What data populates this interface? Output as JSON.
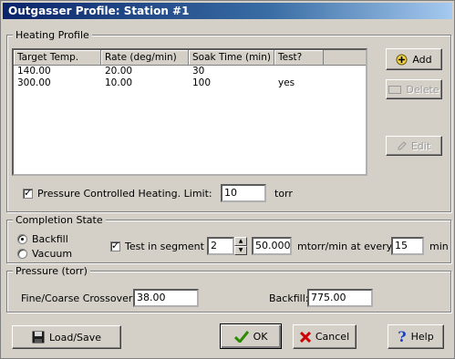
{
  "window": {
    "title": "Outgasser Profile: Station #1"
  },
  "heating_profile": {
    "label": "Heating Profile",
    "columns": [
      "Target Temp.",
      "Rate (deg/min)",
      "Soak Time (min)",
      "Test?"
    ],
    "rows": [
      [
        "140.00",
        "20.00",
        "30",
        ""
      ],
      [
        "300.00",
        "10.00",
        "100",
        "yes"
      ]
    ],
    "add_label": "Add",
    "delete_label": "Delete",
    "edit_label": "Edit",
    "pressure_controlled_label": "Pressure Controlled Heating. Limit:",
    "pressure_controlled_checked": true,
    "limit_value": "10",
    "limit_unit": "torr"
  },
  "completion": {
    "label": "Completion State",
    "backfill_label": "Backfill",
    "vacuum_label": "Vacuum",
    "selected": "Backfill",
    "test_segment_label": "Test in segment",
    "test_segment_checked": true,
    "segment_value": "2",
    "rate_value": "50.000",
    "rate_label": "mtorr/min at every:",
    "every_value": "15",
    "every_unit": "min"
  },
  "pressure": {
    "label": "Pressure (torr)",
    "crossover_label": "Fine/Coarse Crossover:",
    "crossover_value": "38.00",
    "backfill_label": "Backfill:",
    "backfill_value": "775.00"
  },
  "buttons": {
    "load_save": "Load/Save",
    "ok": "OK",
    "cancel": "Cancel",
    "help": "Help"
  },
  "colors": {
    "title_start": "#0a246a",
    "title_end": "#a6caf0",
    "ok_check": "#2e8b00",
    "cancel_x": "#cc0000",
    "help_q": "#1a3fbf"
  }
}
